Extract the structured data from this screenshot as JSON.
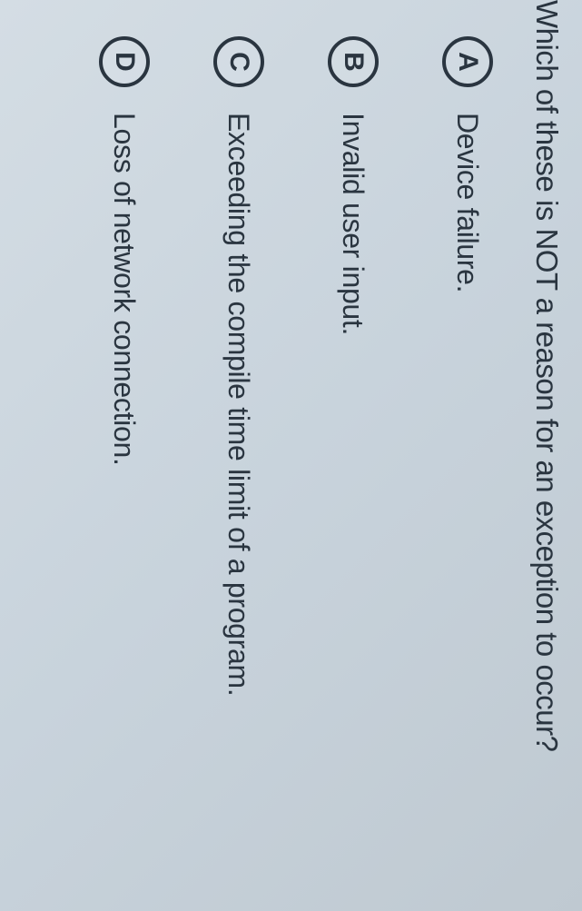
{
  "question": "Which of these is NOT a reason for an exception to occur?",
  "options": [
    {
      "letter": "A",
      "text": "Device failure."
    },
    {
      "letter": "B",
      "text": "Invalid user input."
    },
    {
      "letter": "C",
      "text": "Exceeding the compile time limit of a program."
    },
    {
      "letter": "D",
      "text": "Loss of network connection."
    }
  ]
}
